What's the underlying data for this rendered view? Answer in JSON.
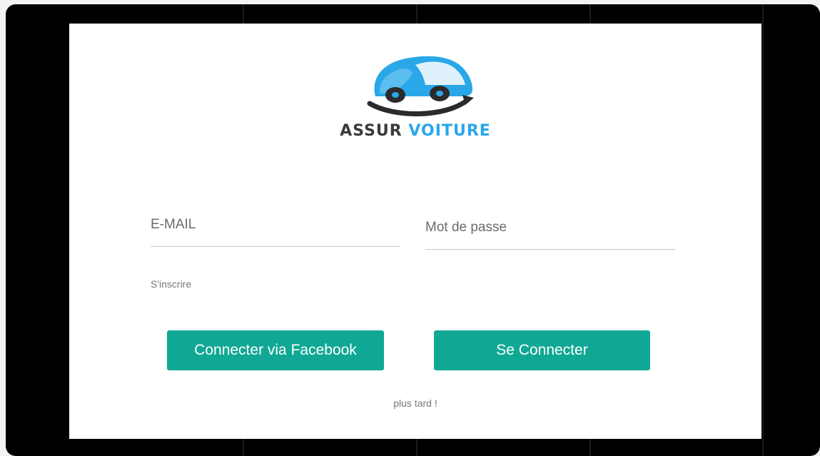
{
  "brand": {
    "word1": "ASSUR",
    "word2": "VOITURE",
    "color_dark": "#3a3a3a",
    "color_blue": "#2aa7e8"
  },
  "form": {
    "email_placeholder": "E-MAIL",
    "password_placeholder": "Mot de passe",
    "signup_link": "S'inscrire",
    "facebook_button": "Connecter via Facebook",
    "login_button": "Se Connecter",
    "later_link": "plus tard !"
  },
  "colors": {
    "accent": "#10a894",
    "frame": "#000000",
    "panel": "#ffffff"
  },
  "icons": [
    "car-logo-icon"
  ]
}
